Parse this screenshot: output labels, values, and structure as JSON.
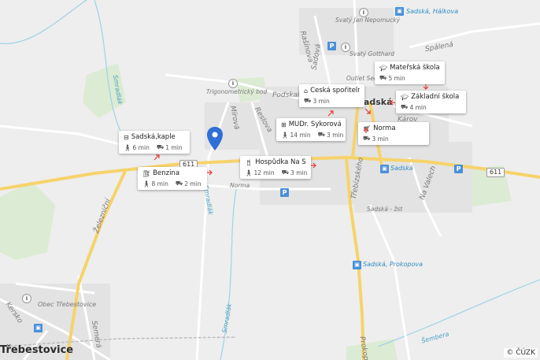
{
  "map": {
    "copyright": "© ČÚZK",
    "accent_color": "#2e6fd8",
    "road_color": "#f6d36b",
    "labels": {
      "towns": [
        "Sadská",
        "Třebestovice",
        "Obec Třebestovice"
      ],
      "streets": [
        "Svatý Jan Nepomucký",
        "Svatý Gotthard",
        "Sadská, Hálkova",
        "Spálená",
        "Outlet Sec",
        "Trigonometrický bod",
        "Podskal",
        "Mírová",
        "Reslova",
        "Károv",
        "Rašínova",
        "Sadová",
        "Třebízského",
        "Na Valech",
        "Železniční",
        "Sadská - žst",
        "Sadská, Prokopova",
        "Kersko",
        "Semerá",
        "Prokop",
        "Šembera",
        "Sadská"
      ],
      "water": [
        "Smradlák",
        "Smradlák",
        "Smradlák"
      ],
      "poi_plain": [
        "Norma"
      ],
      "road_number": "611"
    },
    "pois": [
      {
        "name": "Sadská,kaple",
        "icon": "bus-icon",
        "walk": "6 min",
        "drive": "1 min"
      },
      {
        "name": "Benzina",
        "icon": "gas-icon",
        "walk": "8 min",
        "drive": "2 min"
      },
      {
        "name": "Hospůdka Na Sta...",
        "icon": "restaurant-icon",
        "walk": "12 min",
        "drive": "3 min"
      },
      {
        "name": "MUDr. Sykorová Ji...",
        "icon": "medical-icon",
        "walk": "14 min",
        "drive": "3 min"
      },
      {
        "name": "Česká spořitelna",
        "icon": "bank-icon",
        "walk": "",
        "drive": "3 min"
      },
      {
        "name": "Norma",
        "icon": "shop-icon",
        "walk": "",
        "drive": "3 min"
      },
      {
        "name": "Mateřská škola S...",
        "icon": "school-icon",
        "walk": "",
        "drive": "5 min"
      },
      {
        "name": "Základní škola Sa...",
        "icon": "school-icon",
        "walk": "",
        "drive": "4 min"
      }
    ]
  }
}
